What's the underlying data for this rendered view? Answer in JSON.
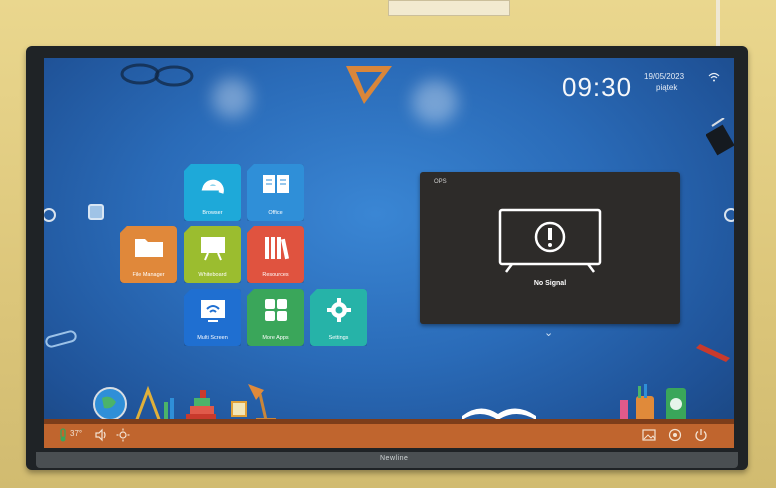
{
  "status_bar": {
    "time": "09:30",
    "date": "19/05/2023",
    "day": "piątek"
  },
  "apps": [
    {
      "label": "Browser",
      "color": "#1ea9d9",
      "icon": "browser-icon"
    },
    {
      "label": "Office",
      "color": "#2f8fd8",
      "icon": "book-icon"
    },
    {
      "label": "File Manager",
      "color": "#e0883a",
      "icon": "folder-icon"
    },
    {
      "label": "Whiteboard",
      "color": "#9bbd2f",
      "icon": "whiteboard-icon"
    },
    {
      "label": "Resources",
      "color": "#e0533f",
      "icon": "books-icon"
    },
    {
      "label": "Multi Screen",
      "color": "#1f6fd1",
      "icon": "wifi-screen-icon"
    },
    {
      "label": "More Apps",
      "color": "#3aa65a",
      "icon": "grid-icon"
    },
    {
      "label": "Settings",
      "color": "#26b3a8",
      "icon": "gear-icon"
    }
  ],
  "source_window": {
    "title": "OPS",
    "message": "No Signal"
  },
  "taskbar": {
    "temperature": "37°",
    "left_icons": [
      "thermometer-icon",
      "volume-icon",
      "brightness-icon"
    ],
    "right_icons": [
      "gallery-icon",
      "settings-icon",
      "power-icon"
    ]
  },
  "brand": "Newline",
  "colors": {
    "screen": "#2a6bb8",
    "taskbar": "#c0652e",
    "panel": "#2d2b29"
  }
}
